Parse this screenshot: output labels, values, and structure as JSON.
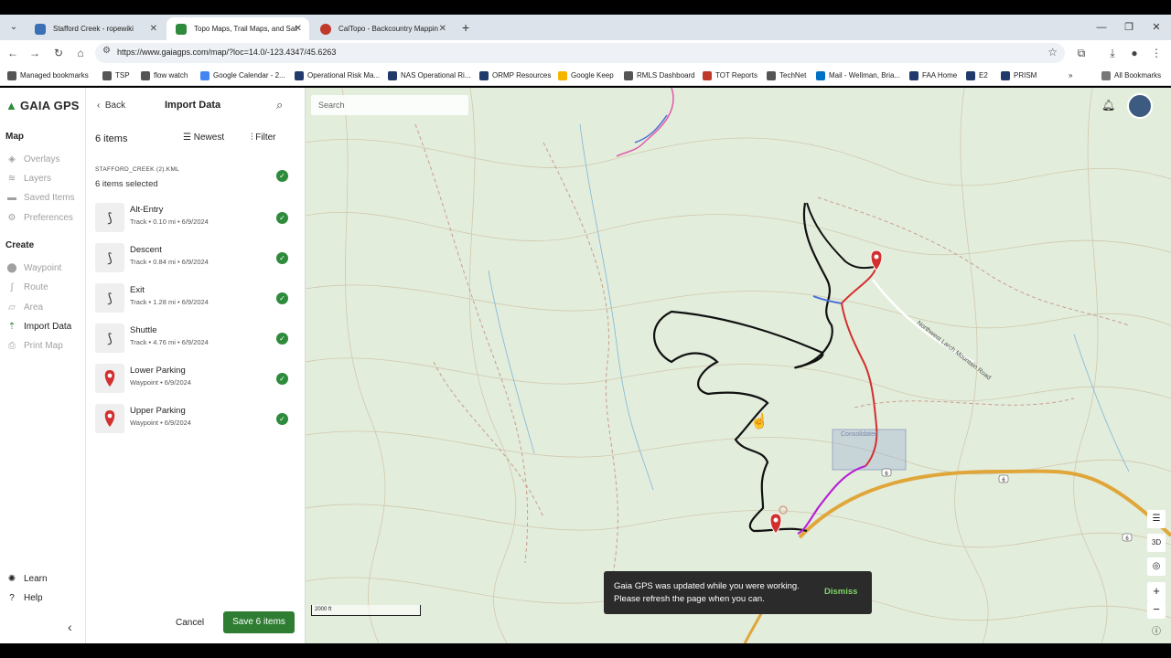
{
  "browser": {
    "tabs": [
      {
        "title": "Stafford Creek - ropewiki",
        "active": false,
        "color": "#3b6fb6"
      },
      {
        "title": "Topo Maps, Trail Maps, and Sat",
        "active": true,
        "color": "#2e8b3b"
      },
      {
        "title": "CalTopo - Backcountry Mappin",
        "active": false,
        "color": "#c0392b"
      }
    ],
    "new_tab": "+",
    "url": "https://www.gaiagps.com/map/?loc=14.0/-123.4347/45.6263",
    "bookmarks": [
      {
        "label": "Managed bookmarks",
        "color": "#555555"
      },
      {
        "label": "TSP",
        "color": "#555555"
      },
      {
        "label": "flow watch",
        "color": "#555555"
      },
      {
        "label": "Google Calendar - 2...",
        "color": "#4285f4"
      },
      {
        "label": "Operational Risk Ma...",
        "color": "#1f3a6b"
      },
      {
        "label": "NAS Operational Ri...",
        "color": "#1f3a6b"
      },
      {
        "label": "ORMP Resources",
        "color": "#1f3a6b"
      },
      {
        "label": "Google Keep",
        "color": "#f4b400"
      },
      {
        "label": "RMLS Dashboard",
        "color": "#555555"
      },
      {
        "label": "TOT Reports",
        "color": "#c0392b"
      },
      {
        "label": "TechNet",
        "color": "#555555"
      },
      {
        "label": "Mail - Wellman, Bria...",
        "color": "#0072c6"
      },
      {
        "label": "FAA Home",
        "color": "#1f3a6b"
      },
      {
        "label": "E2",
        "color": "#1f3a6b"
      },
      {
        "label": "PRISM",
        "color": "#1f3a6b"
      }
    ],
    "all_bookmarks": "All Bookmarks"
  },
  "nav": {
    "brand": "GAIA GPS",
    "map_heading": "Map",
    "map_items": [
      {
        "label": "Overlays",
        "icon": "layers-icon"
      },
      {
        "label": "Layers",
        "icon": "stack-icon"
      },
      {
        "label": "Saved Items",
        "icon": "folder-icon"
      },
      {
        "label": "Preferences",
        "icon": "gear-icon"
      }
    ],
    "create_heading": "Create",
    "create_items": [
      {
        "label": "Waypoint",
        "icon": "pin-icon"
      },
      {
        "label": "Route",
        "icon": "route-icon"
      },
      {
        "label": "Area",
        "icon": "area-icon"
      },
      {
        "label": "Import Data",
        "icon": "import-icon"
      },
      {
        "label": "Print Map",
        "icon": "printer-icon"
      }
    ],
    "learn": "Learn",
    "help": "Help"
  },
  "panel": {
    "back": "Back",
    "title": "Import Data",
    "count": "6 items",
    "sort": "Newest",
    "filter": "Filter",
    "file_name": "STAFFORD_CREEK (2).KML",
    "selected": "6 items selected",
    "items": [
      {
        "name": "Alt-Entry",
        "meta": "Track • 0.10 mi • 6/9/2024",
        "kind": "track"
      },
      {
        "name": "Descent",
        "meta": "Track • 0.84 mi • 6/9/2024",
        "kind": "track"
      },
      {
        "name": "Exit",
        "meta": "Track • 1.28 mi • 6/9/2024",
        "kind": "track"
      },
      {
        "name": "Shuttle",
        "meta": "Track • 4.76 mi • 6/9/2024",
        "kind": "track"
      },
      {
        "name": "Lower Parking",
        "meta": "Waypoint • 6/9/2024",
        "kind": "waypoint"
      },
      {
        "name": "Upper Parking",
        "meta": "Waypoint • 6/9/2024",
        "kind": "waypoint"
      }
    ],
    "cancel": "Cancel",
    "save": "Save 6 items"
  },
  "map": {
    "search_placeholder": "Search",
    "scale": "2000 ft",
    "toast_message": "Gaia GPS was updated while you were working. Please refresh the page when you can.",
    "toast_action": "Dismiss",
    "labels": {
      "road": "Northwest Larch Mountain Road",
      "consolidated": "Consolidated",
      "route6": "6"
    },
    "controls": {
      "three_d": "3D",
      "zoom_in": "+",
      "zoom_out": "−"
    }
  },
  "colors": {
    "brand_green": "#2e8b3b",
    "save_green": "#2e7d32",
    "waypoint_red": "#d32f2f",
    "map_bg": "#e3eddc"
  }
}
